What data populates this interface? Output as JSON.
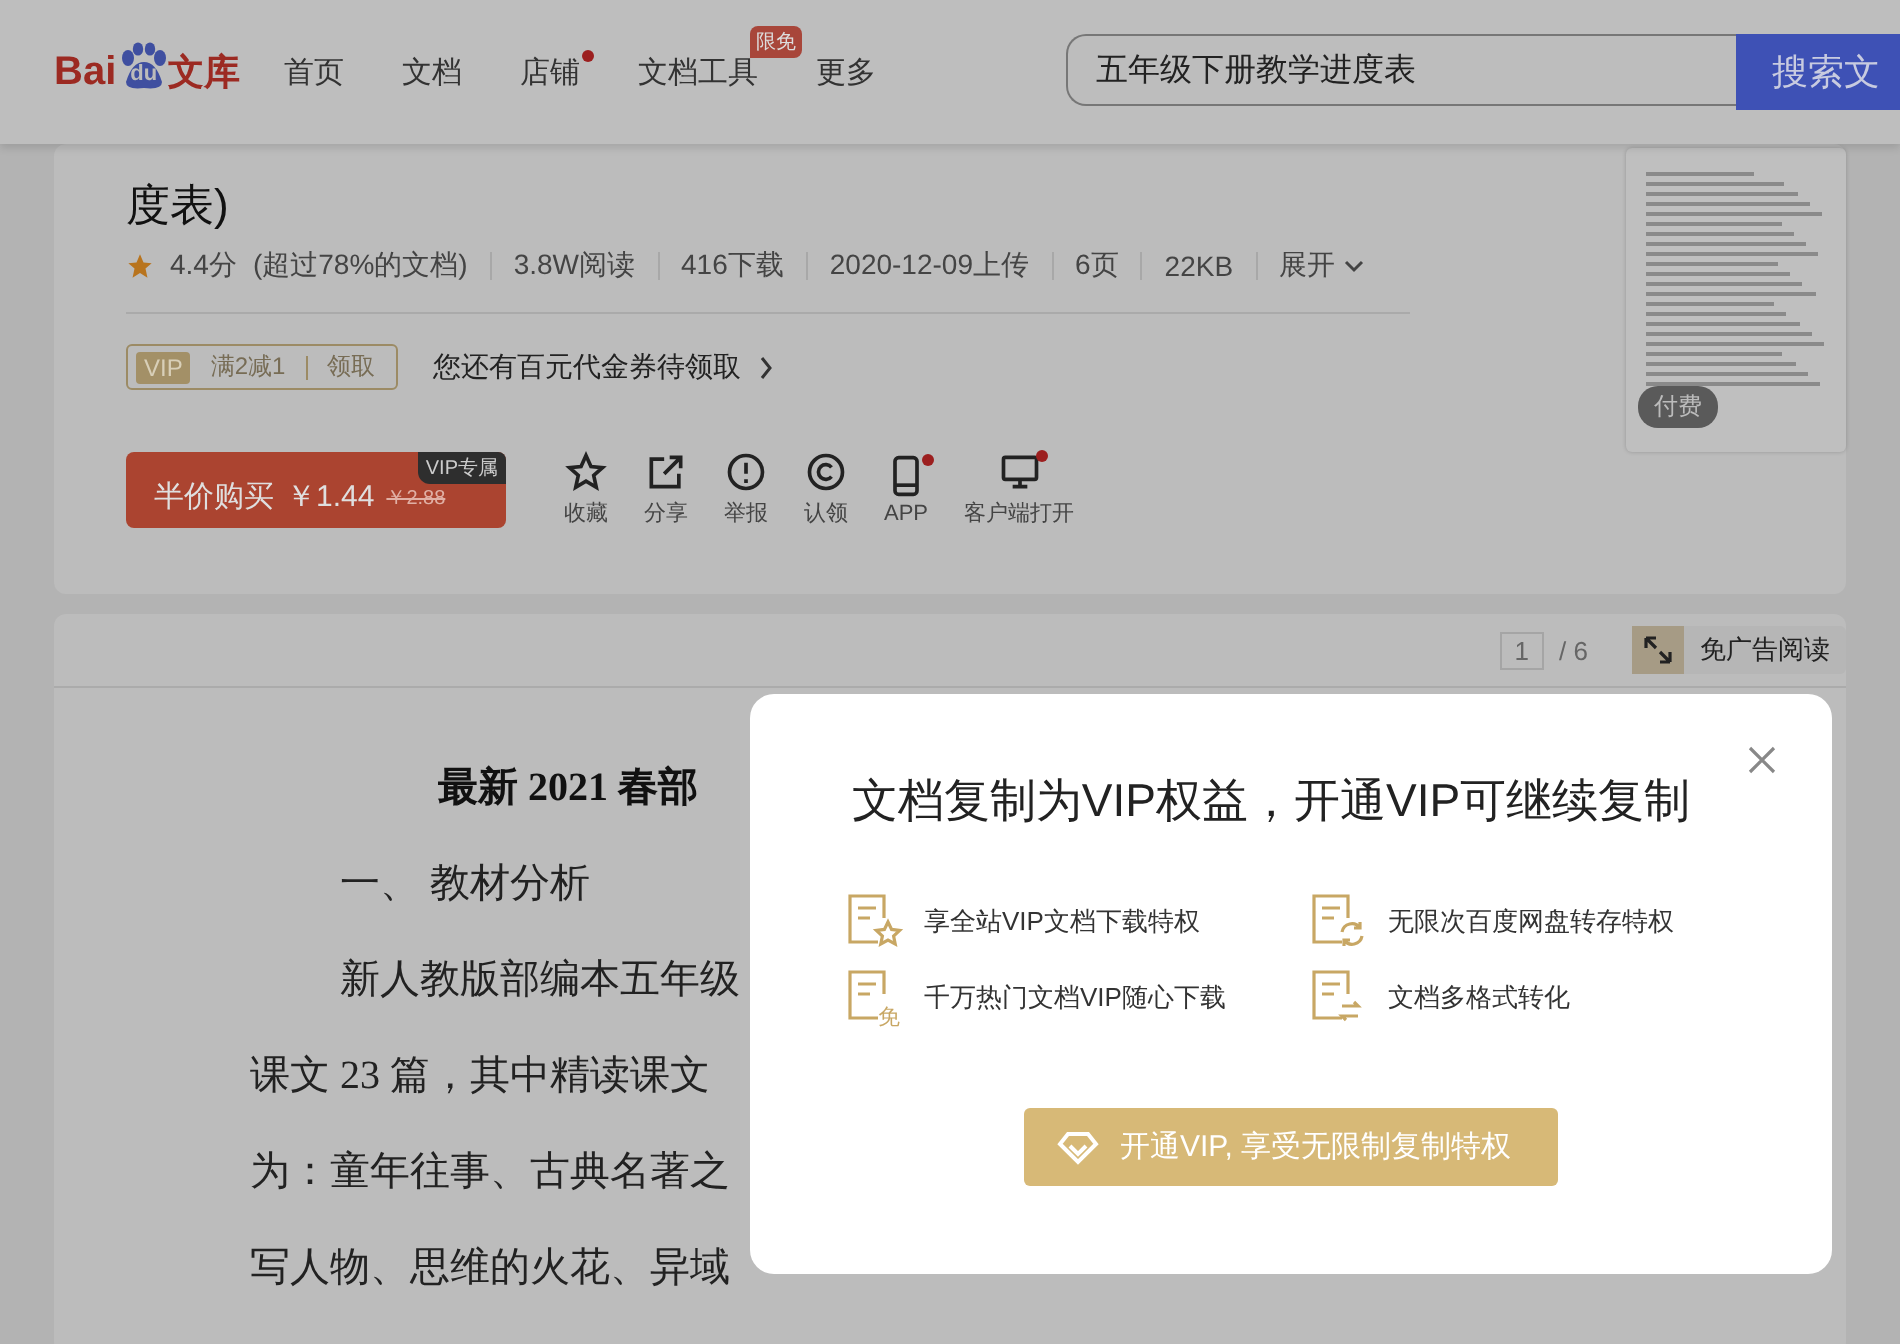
{
  "header": {
    "logo_latin": "Bai",
    "logo_du": "du",
    "logo_cn": "文库",
    "nav": [
      {
        "label": "首页",
        "dot": false
      },
      {
        "label": "文档",
        "dot": false
      },
      {
        "label": "店铺",
        "dot": true
      },
      {
        "label": "文档工具",
        "dot": false,
        "badge": "限免"
      },
      {
        "label": "更多",
        "dot": false
      }
    ],
    "search": {
      "value": "五年级下册教学进度表",
      "button": "搜索文"
    }
  },
  "document": {
    "title": "度表)",
    "rating": "4.4分",
    "rating_note": "(超过78%的文档)",
    "meta": [
      "3.8W阅读",
      "416下载",
      "2020-12-09上传",
      "6页",
      "22KB"
    ],
    "expand": "展开",
    "coupon": {
      "tag": "VIP",
      "offer": "满2减1",
      "claim": "领取",
      "note": "您还有百元代金券待领取"
    },
    "buy": {
      "label": "半价购买",
      "price": "￥1.44",
      "old_price": "￥2.88",
      "badge": "VIP专属"
    },
    "actions": [
      {
        "label": "收藏",
        "kind": "star",
        "dot": false
      },
      {
        "label": "分享",
        "kind": "share",
        "dot": false
      },
      {
        "label": "举报",
        "kind": "report",
        "dot": false
      },
      {
        "label": "认领",
        "kind": "copyright",
        "dot": false
      },
      {
        "label": "APP",
        "kind": "phone",
        "dot": true
      },
      {
        "label": "客户端打开",
        "kind": "monitor",
        "dot": true
      }
    ],
    "thumbnail": {
      "badge": "付费"
    }
  },
  "reader": {
    "page": "1",
    "total": "/ 6",
    "ad_free": "免广告阅读",
    "lines": [
      {
        "kind": "heading",
        "text": "最新 2021 春部"
      },
      {
        "kind": "section",
        "text": "一、 教材分析"
      },
      {
        "kind": "indent",
        "text": "新人教版部编本五年级"
      },
      {
        "kind": "body",
        "text": "课文 23 篇，其中精读课文"
      },
      {
        "kind": "body",
        "text": "为：童年往事、古典名著之"
      },
      {
        "kind": "body",
        "text": "写人物、思维的火花、异域"
      }
    ]
  },
  "modal": {
    "title": "文档复制为VIP权益，开通VIP可继续复制",
    "features": [
      {
        "kind": "star",
        "text": "享全站VIP文档下载特权"
      },
      {
        "kind": "sync",
        "text": "无限次百度网盘转存特权"
      },
      {
        "kind": "free",
        "text": "千万热门文档VIP随心下载",
        "badge": "免"
      },
      {
        "kind": "convert",
        "text": "文档多格式转化"
      }
    ],
    "button": "开通VIP, 享受无限制复制特权"
  }
}
